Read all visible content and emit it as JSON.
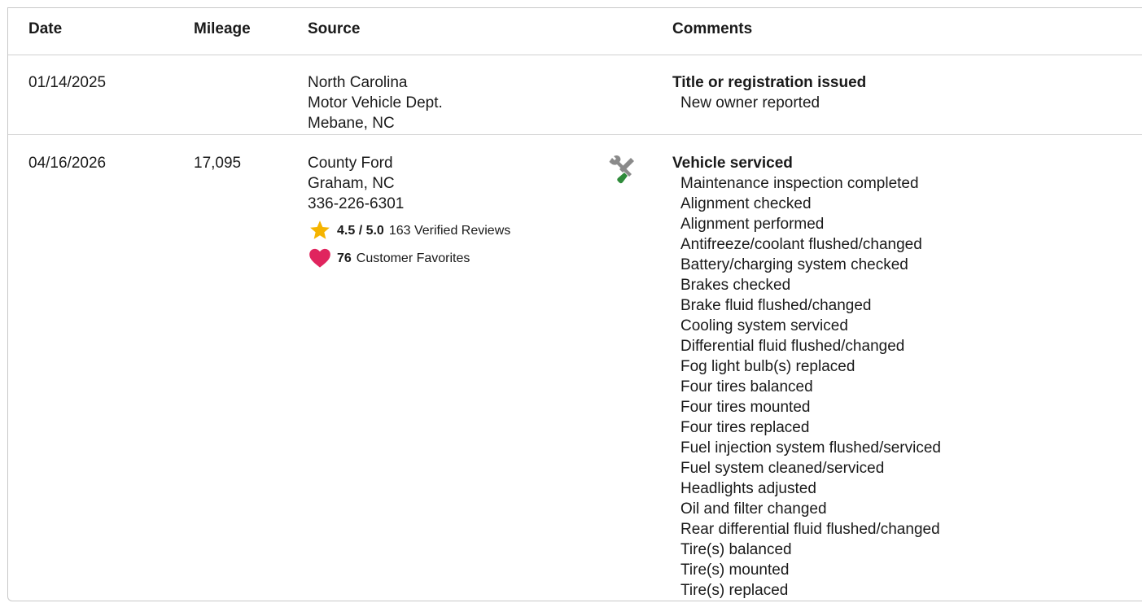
{
  "table": {
    "headers": {
      "date": "Date",
      "mileage": "Mileage",
      "source": "Source",
      "comments": "Comments"
    },
    "rows": [
      {
        "date": "01/14/2025",
        "mileage": "",
        "source": [
          "North Carolina",
          "Motor Vehicle Dept.",
          "Mebane, NC"
        ],
        "comment_title": "Title or registration issued",
        "comment_items": [
          "New owner reported"
        ]
      },
      {
        "date": "04/16/2026",
        "mileage": "17,095",
        "source": [
          "County Ford",
          "Graham, NC",
          "336-226-6301"
        ],
        "rating_value": "4.5 / 5.0",
        "reviews_text": "163 Verified Reviews",
        "favorites_count": "76",
        "favorites_text": "Customer Favorites",
        "icon": "wrench-screwdriver-icon",
        "comment_title": "Vehicle serviced",
        "comment_items": [
          "Maintenance inspection completed",
          "Alignment checked",
          "Alignment performed",
          "Antifreeze/coolant flushed/changed",
          "Battery/charging system checked",
          "Brakes checked",
          "Brake fluid flushed/changed",
          "Cooling system serviced",
          "Differential fluid flushed/changed",
          "Fog light bulb(s) replaced",
          "Four tires balanced",
          "Four tires mounted",
          "Four tires replaced",
          "Fuel injection system flushed/serviced",
          "Fuel system cleaned/serviced",
          "Headlights adjusted",
          "Oil and filter changed",
          "Rear differential fluid flushed/changed",
          "Tire(s) balanced",
          "Tire(s) mounted",
          "Tire(s) replaced"
        ]
      }
    ]
  },
  "colors": {
    "star": "#f5b400",
    "heart": "#e0245e",
    "service_icon_gray": "#8a8a8a",
    "service_icon_green": "#2e8b3a",
    "border": "#d0d0d0"
  }
}
